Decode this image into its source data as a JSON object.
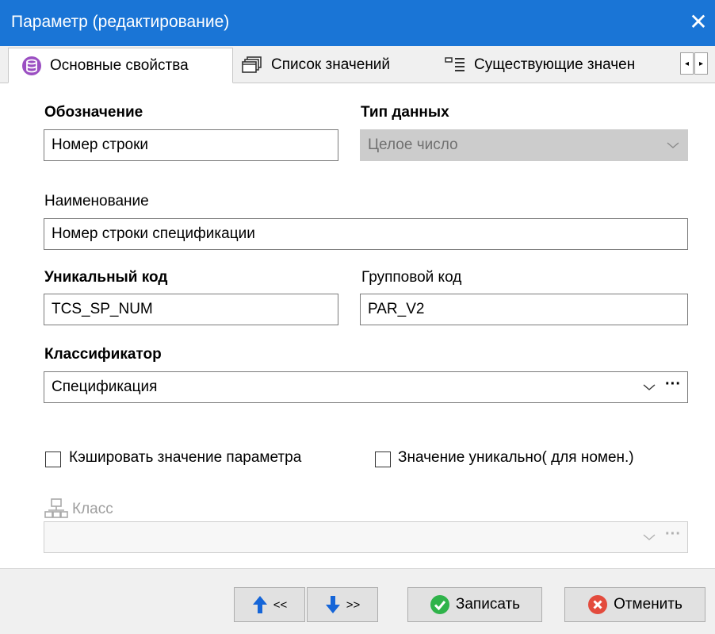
{
  "window": {
    "title": "Параметр (редактирование)",
    "close_glyph": "✕"
  },
  "tabs": [
    {
      "label": "Основные свойства",
      "icon": "database-icon",
      "active": true
    },
    {
      "label": "Список значений",
      "icon": "windows-list-icon",
      "active": false
    },
    {
      "label": "Существующие значен",
      "icon": "list-lines-icon",
      "active": false
    }
  ],
  "tab_scroll": {
    "left": "◂",
    "right": "▸"
  },
  "form": {
    "designation": {
      "label": "Обозначение",
      "value": "Номер строки"
    },
    "data_type": {
      "label": "Тип данных",
      "value": "Целое число"
    },
    "name": {
      "label": "Наименование",
      "value": "Номер строки спецификации"
    },
    "unique_code": {
      "label": "Уникальный код",
      "value": "TCS_SP_NUM"
    },
    "group_code": {
      "label": "Групповой код",
      "value": "PAR_V2"
    },
    "classifier": {
      "label": "Классификатор",
      "value": "Спецификация",
      "ellipsis": "···"
    },
    "cache_value": {
      "label": "Кэшировать значение параметра",
      "checked": false
    },
    "unique_value": {
      "label": "Значение уникально( для номен.)",
      "checked": false
    },
    "class": {
      "label": "Класс",
      "icon": "network-icon",
      "value": "",
      "ellipsis": "···"
    }
  },
  "buttons": {
    "prev": {
      "label": "<<"
    },
    "next": {
      "label": ">>"
    },
    "save": {
      "label": "Записать"
    },
    "cancel": {
      "label": "Отменить"
    }
  },
  "colors": {
    "titlebar": "#1a75d6",
    "save_icon": "#2fb34a",
    "cancel_icon": "#e34b3d",
    "arrow": "#1565d8",
    "tab_icon": "#9b4fc2"
  }
}
